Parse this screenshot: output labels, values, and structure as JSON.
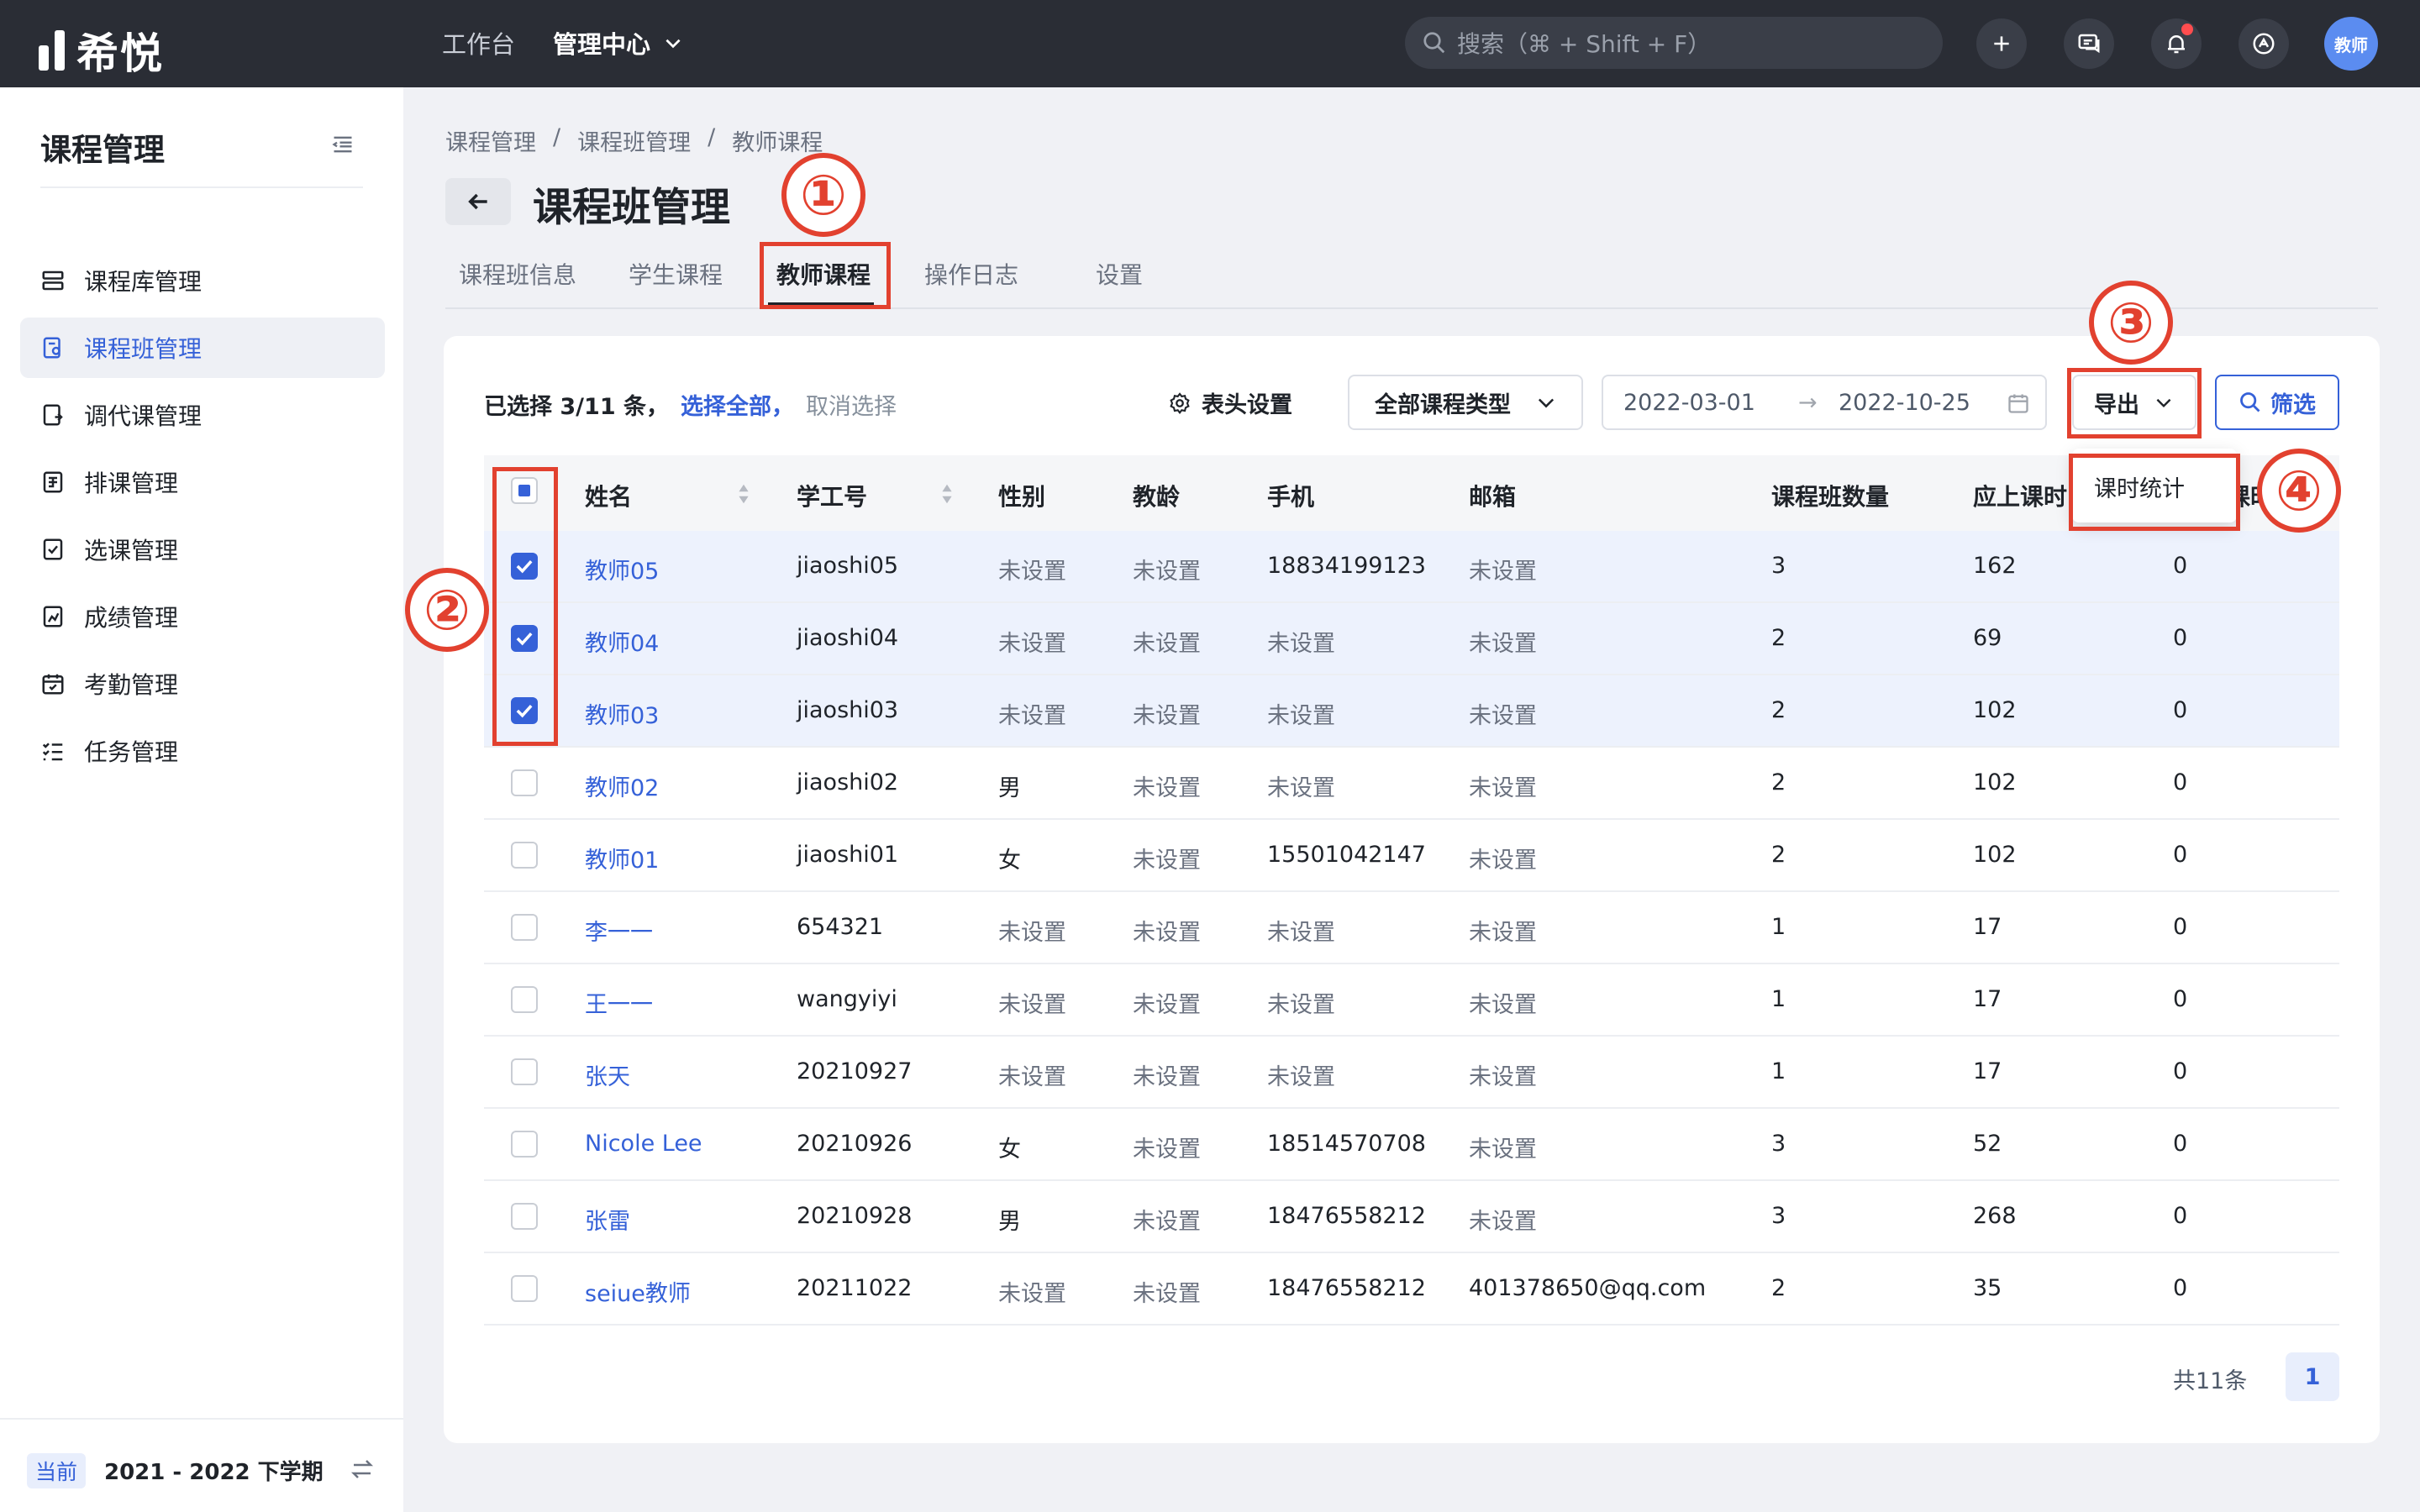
{
  "topbar": {
    "logo_text": "希悦",
    "nav": {
      "workbench": "工作台",
      "admin_center": "管理中心"
    },
    "search_placeholder": "搜索（⌘ + Shift + F）",
    "avatar_text": "教师",
    "icons": [
      "plus-icon",
      "message-icon",
      "bell-icon",
      "help-icon"
    ],
    "notification_dot_color": "#ff4d4f"
  },
  "sidebar": {
    "title": "课程管理",
    "items": [
      {
        "label": "课程库管理",
        "icon": "library-icon"
      },
      {
        "label": "课程班管理",
        "icon": "class-icon",
        "active": true
      },
      {
        "label": "调代课管理",
        "icon": "swap-class-icon"
      },
      {
        "label": "排课管理",
        "icon": "schedule-icon"
      },
      {
        "label": "选课管理",
        "icon": "select-course-icon"
      },
      {
        "label": "成绩管理",
        "icon": "grade-icon"
      },
      {
        "label": "考勤管理",
        "icon": "attendance-icon"
      },
      {
        "label": "任务管理",
        "icon": "task-icon"
      }
    ],
    "footer": {
      "badge": "当前",
      "term": "2021 - 2022 下学期"
    }
  },
  "breadcrumb": [
    "课程管理",
    "课程班管理",
    "教师课程"
  ],
  "breadcrumb_sep": "/",
  "page_title": "课程班管理",
  "tabs": [
    "课程班信息",
    "学生课程",
    "教师课程",
    "操作日志",
    "设置"
  ],
  "active_tab": "教师课程",
  "toolbar": {
    "selection": "已选择 3/11 条，",
    "select_all": "选择全部，",
    "cancel_select": "取消选择",
    "header_settings": "表头设置",
    "course_type": "全部课程类型",
    "date_start": "2022-03-01",
    "date_arrow": "→",
    "date_end": "2022-10-25",
    "export": "导出",
    "filter": "筛选"
  },
  "export_menu": [
    "课时统计"
  ],
  "table": {
    "columns": [
      "姓名",
      "学工号",
      "性别",
      "教龄",
      "手机",
      "邮箱",
      "课程班数量",
      "应上课时",
      "课时"
    ],
    "rows": [
      {
        "name": "教师05",
        "id": "jiaoshi05",
        "gender": "未设置",
        "age": "未设置",
        "phone": "18834199123",
        "email": "未设置",
        "classes": "3",
        "hours": "162",
        "extra": "0",
        "checked": true
      },
      {
        "name": "教师04",
        "id": "jiaoshi04",
        "gender": "未设置",
        "age": "未设置",
        "phone": "未设置",
        "email": "未设置",
        "classes": "2",
        "hours": "69",
        "extra": "0",
        "checked": true
      },
      {
        "name": "教师03",
        "id": "jiaoshi03",
        "gender": "未设置",
        "age": "未设置",
        "phone": "未设置",
        "email": "未设置",
        "classes": "2",
        "hours": "102",
        "extra": "0",
        "checked": true
      },
      {
        "name": "教师02",
        "id": "jiaoshi02",
        "gender": "男",
        "age": "未设置",
        "phone": "未设置",
        "email": "未设置",
        "classes": "2",
        "hours": "102",
        "extra": "0",
        "checked": false
      },
      {
        "name": "教师01",
        "id": "jiaoshi01",
        "gender": "女",
        "age": "未设置",
        "phone": "15501042147",
        "email": "未设置",
        "classes": "2",
        "hours": "102",
        "extra": "0",
        "checked": false
      },
      {
        "name": "李一一",
        "id": "654321",
        "gender": "未设置",
        "age": "未设置",
        "phone": "未设置",
        "email": "未设置",
        "classes": "1",
        "hours": "17",
        "extra": "0",
        "checked": false
      },
      {
        "name": "王一一",
        "id": "wangyiyi",
        "gender": "未设置",
        "age": "未设置",
        "phone": "未设置",
        "email": "未设置",
        "classes": "1",
        "hours": "17",
        "extra": "0",
        "checked": false
      },
      {
        "name": "张天",
        "id": "20210927",
        "gender": "未设置",
        "age": "未设置",
        "phone": "未设置",
        "email": "未设置",
        "classes": "1",
        "hours": "17",
        "extra": "0",
        "checked": false
      },
      {
        "name": "Nicole Lee",
        "id": "20210926",
        "gender": "女",
        "age": "未设置",
        "phone": "18514570708",
        "email": "未设置",
        "classes": "3",
        "hours": "52",
        "extra": "0",
        "checked": false
      },
      {
        "name": "张雷",
        "id": "20210928",
        "gender": "男",
        "age": "未设置",
        "phone": "18476558212",
        "email": "未设置",
        "classes": "3",
        "hours": "268",
        "extra": "0",
        "checked": false
      },
      {
        "name": "seiue教师",
        "id": "20211022",
        "gender": "未设置",
        "age": "未设置",
        "phone": "18476558212",
        "email": "401378650@qq.com",
        "classes": "2",
        "hours": "35",
        "extra": "0",
        "checked": false
      }
    ]
  },
  "pagination": {
    "total": "共11条",
    "current": "1"
  },
  "annotations": [
    "①",
    "②",
    "③",
    "④"
  ],
  "colors": {
    "accent": "#3561d8",
    "annotation": "#e2412f",
    "topbar": "#2a2d35",
    "selected_row": "#edf2fd"
  }
}
